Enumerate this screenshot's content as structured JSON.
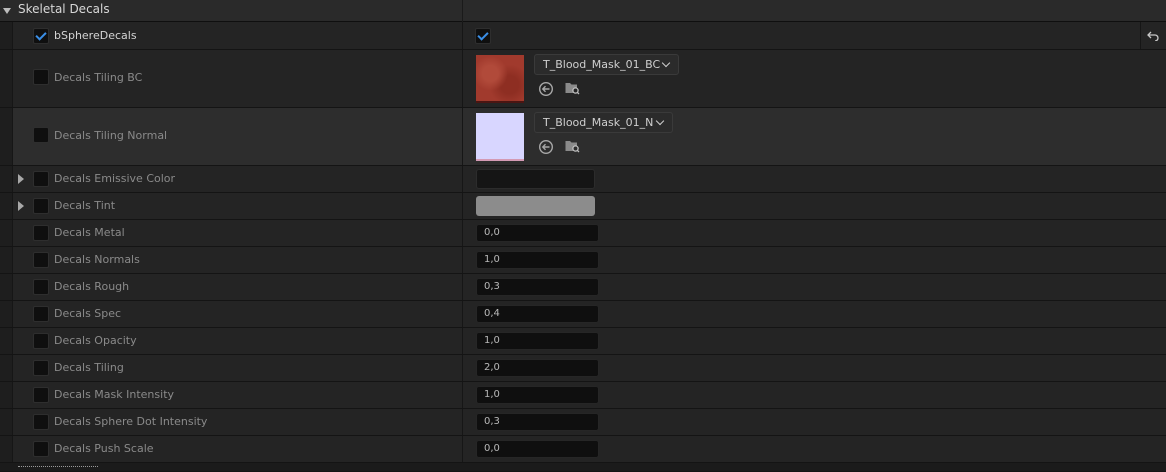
{
  "section": {
    "title": "Skeletal Decals"
  },
  "rows": [
    {
      "label": "bSphereDecals",
      "value_checked": true
    },
    {
      "label": "Decals Tiling BC",
      "asset": "T_Blood_Mask_01_BC"
    },
    {
      "label": "Decals Tiling Normal",
      "asset": "T_Blood_Mask_01_N"
    },
    {
      "label": "Decals Emissive Color",
      "color": "#151515"
    },
    {
      "label": "Decals Tint",
      "color": "#8c8c8c"
    },
    {
      "label": "Decals Metal",
      "value": "0,0"
    },
    {
      "label": "Decals Normals",
      "value": "1,0"
    },
    {
      "label": "Decals Rough",
      "value": "0,3"
    },
    {
      "label": "Decals Spec",
      "value": "0,4"
    },
    {
      "label": "Decals Opacity",
      "value": "1,0"
    },
    {
      "label": "Decals Tiling",
      "value": "2,0"
    },
    {
      "label": "Decals Mask Intensity",
      "value": "1,0"
    },
    {
      "label": "Decals Sphere Dot Intensity",
      "value": "0,3"
    },
    {
      "label": "Decals Push Scale",
      "value": "0,0"
    }
  ],
  "colors": {
    "check_accent": "#3a8ee6",
    "panel": "#242424",
    "field": "#0f0f0f"
  },
  "icons": {
    "browse": "arrow-left-circle-icon",
    "find": "folder-search-icon",
    "reset": "reset-to-default-icon"
  }
}
